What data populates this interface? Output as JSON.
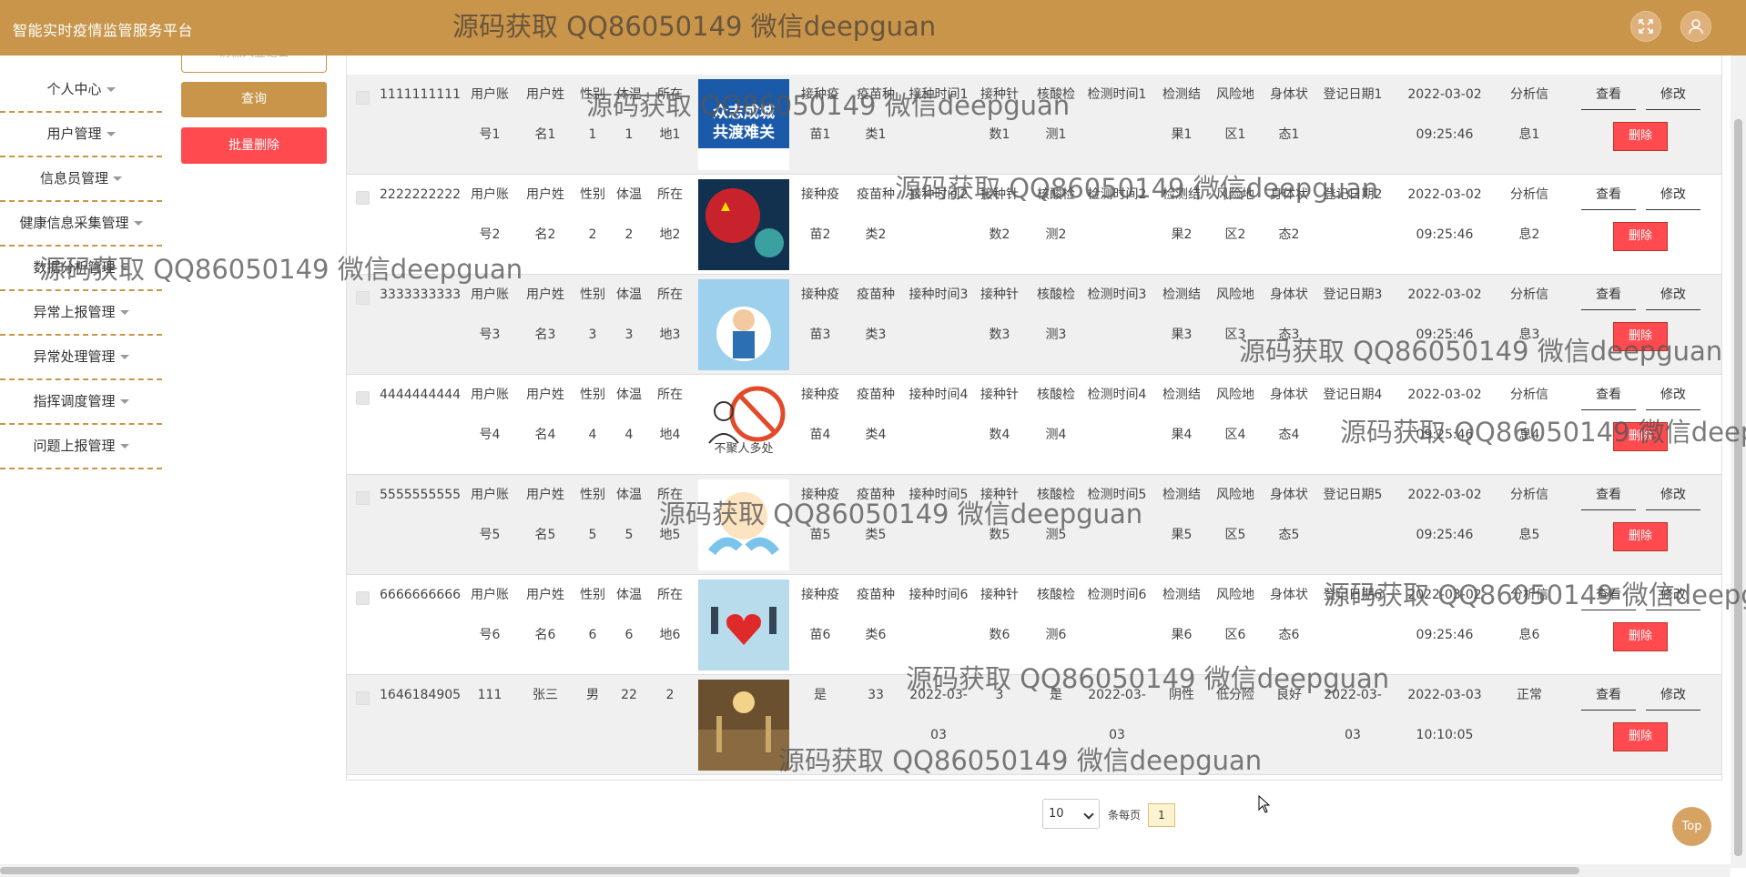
{
  "header": {
    "title": "智能实时疫情监管服务平台",
    "watermark": "源码获取 QQ86050149 微信deepguan",
    "fullscreen_icon": "expand-icon",
    "user_icon": "user-icon"
  },
  "sidebar": {
    "items": [
      {
        "label": "个人中心"
      },
      {
        "label": "用户管理"
      },
      {
        "label": "信息员管理"
      },
      {
        "label": "健康信息采集管理"
      },
      {
        "label": "数据分析管理"
      },
      {
        "label": "异常上报管理"
      },
      {
        "label": "异常处理管理"
      },
      {
        "label": "指挥调度管理"
      },
      {
        "label": "问题上报管理"
      }
    ]
  },
  "actions": {
    "search_input_placeholder": "请输入登记日",
    "query_label": "查询",
    "batch_delete_label": "批量删除"
  },
  "table": {
    "view_label": "查看",
    "edit_label": "修改",
    "delete_label": "删除",
    "rows": [
      {
        "id": "1111111111",
        "c1": [
          "用户账",
          "号1"
        ],
        "c2": [
          "用户姓",
          "名1"
        ],
        "c3": [
          "性别",
          "1"
        ],
        "c4": [
          "体温",
          "1"
        ],
        "c5": [
          "所在",
          "地1"
        ],
        "img": "covid-banner",
        "c6": [
          "接种疫",
          "苗1"
        ],
        "c7": [
          "疫苗种",
          "类1"
        ],
        "c8": [
          "接种时间1",
          ""
        ],
        "c9": [
          "接种针",
          "数1"
        ],
        "c10": [
          "核酸检",
          "测1"
        ],
        "c11": [
          "检测时间1",
          ""
        ],
        "c12": [
          "检测结",
          "果1"
        ],
        "c13": [
          "风险地",
          "区1"
        ],
        "c14": [
          "身体状",
          "态1"
        ],
        "c15": [
          "登记日期1",
          ""
        ],
        "c16": [
          "2022-03-02",
          "09:25:46"
        ],
        "c17": [
          "分析信",
          "息1"
        ]
      },
      {
        "id": "2222222222",
        "c1": [
          "用户账",
          "号2"
        ],
        "c2": [
          "用户姓",
          "名2"
        ],
        "c3": [
          "性别",
          "2"
        ],
        "c4": [
          "体温",
          "2"
        ],
        "c5": [
          "所在",
          "地2"
        ],
        "img": "virus-fist",
        "c6": [
          "接种疫",
          "苗2"
        ],
        "c7": [
          "疫苗种",
          "类2"
        ],
        "c8": [
          "接种时间2",
          ""
        ],
        "c9": [
          "接种针",
          "数2"
        ],
        "c10": [
          "核酸检",
          "测2"
        ],
        "c11": [
          "检测时间2",
          ""
        ],
        "c12": [
          "检测结",
          "果2"
        ],
        "c13": [
          "风险地",
          "区2"
        ],
        "c14": [
          "身体状",
          "态2"
        ],
        "c15": [
          "登记日期2",
          ""
        ],
        "c16": [
          "2022-03-02",
          "09:25:46"
        ],
        "c17": [
          "分析信",
          "息2"
        ]
      },
      {
        "id": "3333333333",
        "c1": [
          "用户账",
          "号3"
        ],
        "c2": [
          "用户姓",
          "名3"
        ],
        "c3": [
          "性别",
          "3"
        ],
        "c4": [
          "体温",
          "3"
        ],
        "c5": [
          "所在",
          "地3"
        ],
        "img": "doctor",
        "c6": [
          "接种疫",
          "苗3"
        ],
        "c7": [
          "疫苗种",
          "类3"
        ],
        "c8": [
          "接种时间3",
          ""
        ],
        "c9": [
          "接种针",
          "数3"
        ],
        "c10": [
          "核酸检",
          "测3"
        ],
        "c11": [
          "检测时间3",
          ""
        ],
        "c12": [
          "检测结",
          "果3"
        ],
        "c13": [
          "风险地",
          "区3"
        ],
        "c14": [
          "身体状",
          "态3"
        ],
        "c15": [
          "登记日期3",
          ""
        ],
        "c16": [
          "2022-03-02",
          "09:25:46"
        ],
        "c17": [
          "分析信",
          "息3"
        ]
      },
      {
        "id": "4444444444",
        "c1": [
          "用户账",
          "号4"
        ],
        "c2": [
          "用户姓",
          "名4"
        ],
        "c3": [
          "性别",
          "4"
        ],
        "c4": [
          "体温",
          "4"
        ],
        "c5": [
          "所在",
          "地4"
        ],
        "img": "no-gathering",
        "img_text": "不聚人多处",
        "c6": [
          "接种疫",
          "苗4"
        ],
        "c7": [
          "疫苗种",
          "类4"
        ],
        "c8": [
          "接种时间4",
          ""
        ],
        "c9": [
          "接种针",
          "数4"
        ],
        "c10": [
          "核酸检",
          "测4"
        ],
        "c11": [
          "检测时间4",
          ""
        ],
        "c12": [
          "检测结",
          "果4"
        ],
        "c13": [
          "风险地",
          "区4"
        ],
        "c14": [
          "身体状",
          "态4"
        ],
        "c15": [
          "登记日期4",
          ""
        ],
        "c16": [
          "2022-03-02",
          "09:25:46"
        ],
        "c17": [
          "分析信",
          "息4"
        ]
      },
      {
        "id": "5555555555",
        "c1": [
          "用户账",
          "号5"
        ],
        "c2": [
          "用户姓",
          "名5"
        ],
        "c3": [
          "性别",
          "5"
        ],
        "c4": [
          "体温",
          "5"
        ],
        "c5": [
          "所在",
          "地5"
        ],
        "img": "hands-care",
        "c6": [
          "接种疫",
          "苗5"
        ],
        "c7": [
          "疫苗种",
          "类5"
        ],
        "c8": [
          "接种时间5",
          ""
        ],
        "c9": [
          "接种针",
          "数5"
        ],
        "c10": [
          "核酸检",
          "测5"
        ],
        "c11": [
          "检测时间5",
          ""
        ],
        "c12": [
          "检测结",
          "果5"
        ],
        "c13": [
          "风险地",
          "区5"
        ],
        "c14": [
          "身体状",
          "态5"
        ],
        "c15": [
          "登记日期5",
          ""
        ],
        "c16": [
          "2022-03-02",
          "09:25:46"
        ],
        "c17": [
          "分析信",
          "息5"
        ]
      },
      {
        "id": "6666666666",
        "c1": [
          "用户账",
          "号6"
        ],
        "c2": [
          "用户姓",
          "名6"
        ],
        "c3": [
          "性别",
          "6"
        ],
        "c4": [
          "体温",
          "6"
        ],
        "c5": [
          "所在",
          "地6"
        ],
        "img": "heart-people",
        "c6": [
          "接种疫",
          "苗6"
        ],
        "c7": [
          "疫苗种",
          "类6"
        ],
        "c8": [
          "接种时间6",
          ""
        ],
        "c9": [
          "接种针",
          "数6"
        ],
        "c10": [
          "核酸检",
          "测6"
        ],
        "c11": [
          "检测时间6",
          ""
        ],
        "c12": [
          "检测结",
          "果6"
        ],
        "c13": [
          "风险地",
          "区6"
        ],
        "c14": [
          "身体状",
          "态6"
        ],
        "c15": [
          "登记日期6",
          ""
        ],
        "c16": [
          "2022-03-02",
          "09:25:46"
        ],
        "c17": [
          "分析信",
          "息6"
        ]
      },
      {
        "id": "1646184905",
        "c1": [
          "111",
          ""
        ],
        "c2": [
          "张三",
          ""
        ],
        "c3": [
          "男",
          ""
        ],
        "c4": [
          "22",
          ""
        ],
        "c5": [
          "2",
          ""
        ],
        "img": "hotel-lobby",
        "c6": [
          "是",
          ""
        ],
        "c7": [
          "33",
          ""
        ],
        "c8": [
          "2022-03-",
          "03"
        ],
        "c9": [
          "3",
          ""
        ],
        "c10": [
          "是",
          ""
        ],
        "c11": [
          "2022-03-",
          "03"
        ],
        "c12": [
          "阴性",
          ""
        ],
        "c13": [
          "低分险",
          ""
        ],
        "c14": [
          "良好",
          ""
        ],
        "c15": [
          "2022-03-",
          "03"
        ],
        "c16": [
          "2022-03-03",
          "10:10:05"
        ],
        "c17": [
          "正常",
          ""
        ]
      }
    ]
  },
  "pagination": {
    "page_size": "10",
    "per_page_label": "条每页",
    "current_page": "1"
  },
  "top_button": "Top",
  "watermark_text": "源码获取 QQ86050149 微信deepguan"
}
